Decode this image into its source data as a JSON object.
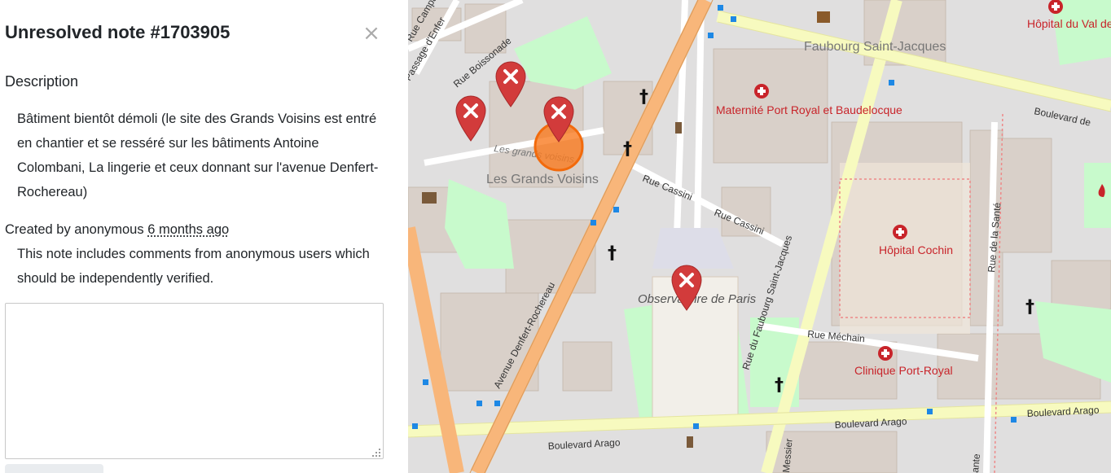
{
  "note": {
    "title": "Unresolved note #1703905",
    "close_symbol": "×",
    "description_heading": "Description",
    "description": "Bâtiment bientôt démoli (le site des Grands Voisins est entré en chantier et se resséré sur les bâtiments Antoine Colombani, La lingerie et ceux donnant sur l'avenue Denfert-Rochereau)",
    "created_prefix": "Created by anonymous ",
    "created_time": "6 months ago",
    "anonymous_warning": "This note includes comments from anonymous users which should be independently verified.",
    "comment_value": ""
  },
  "map": {
    "labels": {
      "rue_campagne": "Rue Campagne",
      "passage_enfer": "Passage d'Enfer",
      "rue_boissonade": "Rue Boissonade",
      "les_grands_voisins_italic": "Les grands voisins",
      "les_grands_voisins": "Les Grands Voisins",
      "faubourg_saint_jacques": "Faubourg Saint-Jacques",
      "maternite": "Maternité Port Royal et Baudelocque",
      "hopital_val_de_grace": "Hôpital du Val de Grâce",
      "boulevard_de_port_royal": "Boulevard de",
      "rue_cassini_1": "Rue Cassini",
      "rue_cassini_2": "Rue Cassini",
      "avenue_denfert": "Avenue Denfert-Rochereau",
      "rue_faubourg_saint_jacques": "Rue du Faubourg Saint-Jacques",
      "hopital_cochin": "Hôpital Cochin",
      "rue_de_la_sante": "Rue de la Santé",
      "observatoire": "Observatoire de Paris",
      "rue_mechain": "Rue Méchain",
      "clinique": "Clinique Port-Royal",
      "boulevard_arago_1": "Boulevard Arago",
      "boulevard_arago_2": "Boulevard Arago",
      "boulevard_arago_3": "Boulevard Arago",
      "messier": "Messier",
      "sante_bottom": "ante"
    },
    "colors": {
      "note_marker": "#d23b3b",
      "selected_highlight": "#f97b21",
      "main_road": "#f8b67a",
      "secondary_road": "#f7fabf",
      "park": "#c8facc",
      "hospital_label": "#c8242a"
    }
  }
}
